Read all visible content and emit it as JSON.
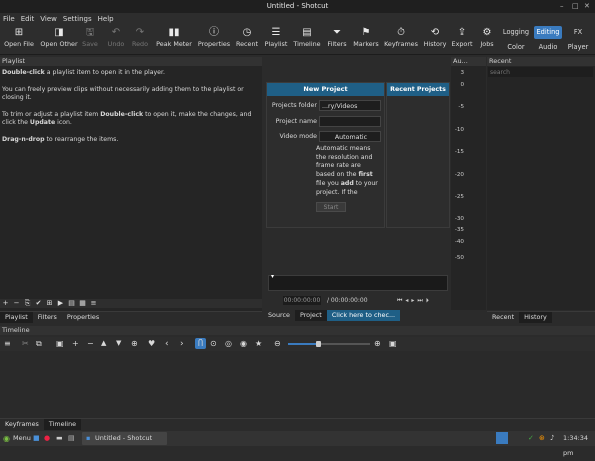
{
  "window": {
    "title": "Untitled - Shotcut",
    "min": "–",
    "max": "□",
    "close": "✕"
  },
  "menu": [
    "File",
    "Edit",
    "View",
    "Settings",
    "Help"
  ],
  "toolbar": [
    {
      "icon": "⊞",
      "label": "Open File"
    },
    {
      "icon": "◨",
      "label": "Open Other",
      "dropdown": "▾"
    },
    {
      "icon": "🖫",
      "label": "Save",
      "disabled": true
    },
    {
      "icon": "↶",
      "label": "Undo",
      "disabled": true
    },
    {
      "icon": "↷",
      "label": "Redo",
      "disabled": true
    },
    {
      "icon": "▮▮",
      "label": "Peak Meter"
    },
    {
      "icon": "ⓘ",
      "label": "Properties"
    },
    {
      "icon": "◷",
      "label": "Recent"
    },
    {
      "icon": "☰",
      "label": "Playlist"
    },
    {
      "icon": "▤",
      "label": "Timeline"
    },
    {
      "icon": "⏷",
      "label": "Filters"
    },
    {
      "icon": "⚑",
      "label": "Markers"
    },
    {
      "icon": "⏱",
      "label": "Keyframes"
    },
    {
      "icon": "⟲",
      "label": "History"
    },
    {
      "icon": "⇪",
      "label": "Export"
    },
    {
      "icon": "⚙",
      "label": "Jobs"
    }
  ],
  "layouts": {
    "logging": "Logging",
    "editing": "Editing",
    "fx": "FX",
    "color": "Color",
    "audio": "Audio",
    "player": "Player"
  },
  "playlist": {
    "title": "Playlist",
    "p1_bold": "Double-click",
    "p1_rest": " a playlist item to open it in the player.",
    "p2": "You can freely preview clips without necessarily adding them to the playlist or closing it.",
    "p3_a": "To trim or adjust a playlist item ",
    "p3_bold": "Double-click",
    "p3_b": " to open it, make the changes, and click the ",
    "p3_bold2": "Update",
    "p3_c": " icon.",
    "p4_bold": "Drag-n-drop",
    "p4_rest": " to rearrange the items.",
    "icons": [
      "+",
      "−",
      "⎘",
      "✔",
      "⊞",
      "▶",
      "▤",
      "▦",
      "≡"
    ],
    "tabs": [
      "Playlist",
      "Filters",
      "Properties"
    ]
  },
  "new_project": {
    "title": "New Project",
    "folder_label": "Projects folder",
    "folder_value": "...ry/Videos",
    "name_label": "Project name",
    "name_value": "",
    "mode_label": "Video mode",
    "mode_value": "Automatic",
    "desc_a": "Automatic means the resolution and frame rate are based on the ",
    "desc_b1": "first",
    "desc_b": " file you ",
    "desc_b2": "add",
    "desc_c": " to your project. If the",
    "start": "Start"
  },
  "recent_projects": {
    "title": "Recent Projects"
  },
  "meter": {
    "title": "Au...",
    "scale": [
      "3",
      "0",
      "-5",
      "-10",
      "-15",
      "-20",
      "-25",
      "-30",
      "-35",
      "-40",
      "-50"
    ]
  },
  "recent": {
    "title": "Recent",
    "search_placeholder": "search"
  },
  "player": {
    "timecode": "00:00:00:00",
    "duration": "/ 00:00:00:00",
    "tabs": [
      "Source",
      "Project"
    ],
    "notice": "Click here to chec..."
  },
  "right_tabs": [
    "Recent",
    "History"
  ],
  "timeline": {
    "title": "Timeline",
    "tools": [
      "≡",
      "✂",
      "⧉",
      "▣",
      "+",
      "−",
      "▲",
      "▼",
      "⊕",
      "♥",
      "‹",
      "›",
      "Ⴖ",
      "⊙",
      "◎",
      "◉",
      "★"
    ],
    "bottom_tabs": [
      "Keyframes",
      "Timeline"
    ]
  },
  "taskbar": {
    "menu": "Menu",
    "app": "Untitled - Shotcut",
    "clock": "1:34:34 pm"
  }
}
